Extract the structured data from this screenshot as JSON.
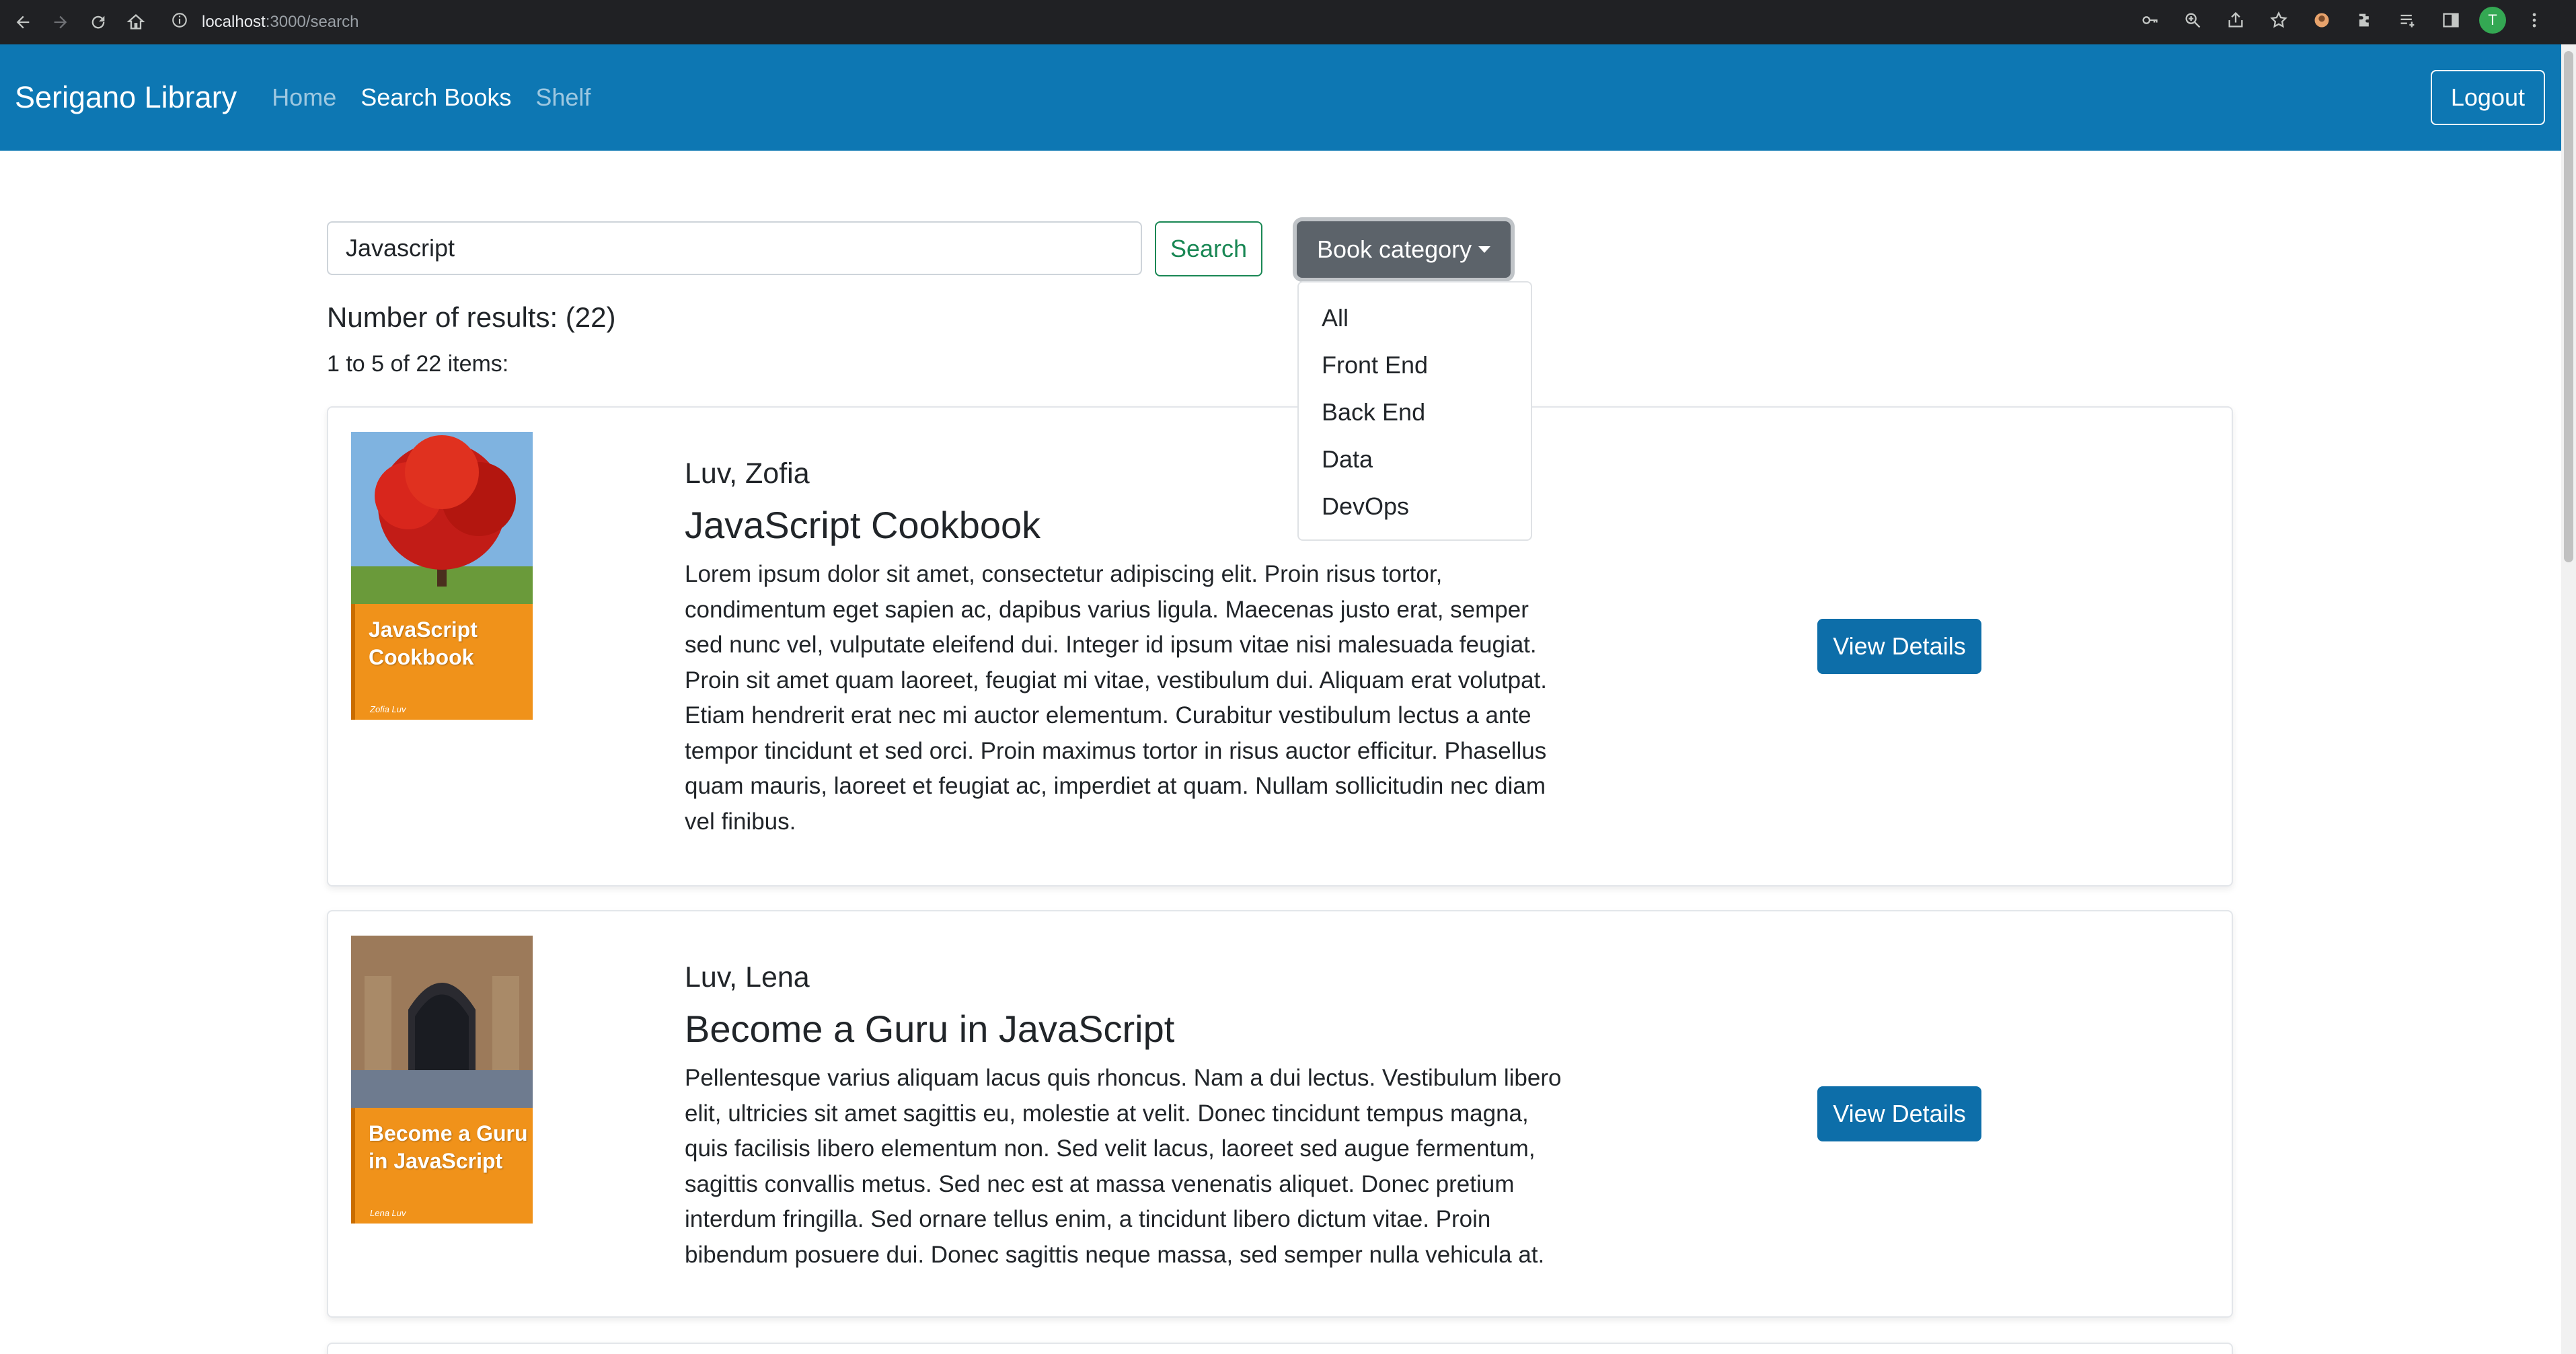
{
  "browser": {
    "url_host": "localhost",
    "url_rest": ":3000/search",
    "profile_initial": "T"
  },
  "navbar": {
    "brand": "Serigano Library",
    "links": [
      {
        "label": "Home"
      },
      {
        "label": "Search Books"
      },
      {
        "label": "Shelf"
      }
    ],
    "logout_label": "Logout",
    "color": "#0d77b3"
  },
  "search": {
    "value": "Javascript",
    "button_label": "Search",
    "category_label": "Book category",
    "category_options": [
      "All",
      "Front End",
      "Back End",
      "Data",
      "DevOps"
    ]
  },
  "results": {
    "title": "Number of results: (22)",
    "subtitle": "1 to 5 of 22 items:"
  },
  "books": [
    {
      "author": "Luv, Zofia",
      "title": "JavaScript Cookbook",
      "cover_title_line1": "JavaScript",
      "cover_title_line2": "Cookbook",
      "cover_author": "Zofia Luv",
      "description": "Lorem ipsum dolor sit amet, consectetur adipiscing elit. Proin risus tortor, condimentum eget sapien ac, dapibus varius ligula. Maecenas justo erat, semper sed nunc vel, vulputate eleifend dui. Integer id ipsum vitae nisi malesuada feugiat. Proin sit amet quam laoreet, feugiat mi vitae, vestibulum dui. Aliquam erat volutpat. Etiam hendrerit erat nec mi auctor elementum. Curabitur vestibulum lectus a ante tempor tincidunt et sed orci. Proin maximus tortor in risus auctor efficitur. Phasellus quam mauris, laoreet et feugiat ac, imperdiet at quam. Nullam sollicitudin nec diam vel finibus.",
      "button_label": "View Details"
    },
    {
      "author": "Luv, Lena",
      "title": "Become a Guru in JavaScript",
      "cover_title_line1": "Become a Guru",
      "cover_title_line2": "in JavaScript",
      "cover_author": "Lena Luv",
      "description": "Pellentesque varius aliquam lacus quis rhoncus. Nam a dui lectus. Vestibulum libero elit, ultricies sit amet sagittis eu, molestie at velit. Donec tincidunt tempus magna, quis facilisis libero elementum non. Sed velit lacus, laoreet sed augue fermentum, sagittis convallis metus. Sed nec est at massa venenatis aliquet. Donec pretium interdum fringilla. Sed ornare tellus enim, a tincidunt libero dictum vitae. Proin bibendum posuere dui. Donec sagittis neque massa, sed semper nulla vehicula at.",
      "button_label": "View Details"
    }
  ]
}
